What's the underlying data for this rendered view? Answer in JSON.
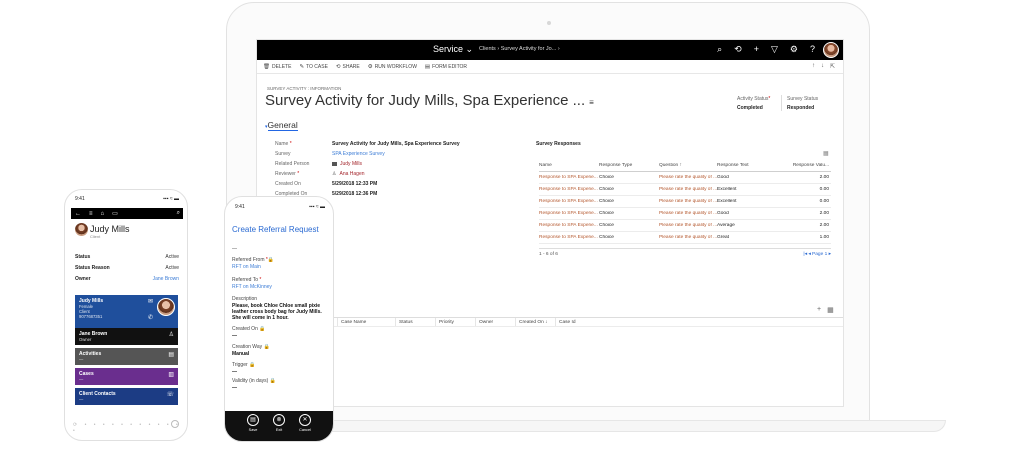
{
  "laptop": {
    "topbar": {
      "app_name": "Service ⌄",
      "breadcrumb": "Clients  ›  Survey Activity for Jo...  ›",
      "icons": [
        "search-icon",
        "history-icon",
        "plus-icon",
        "filter-icon",
        "gear-icon",
        "help-icon"
      ]
    },
    "commands": [
      {
        "icon": "🗑",
        "label": "DELETE"
      },
      {
        "icon": "✎",
        "label": "TO CASE"
      },
      {
        "icon": "⟲",
        "label": "SHARE"
      },
      {
        "icon": "⚙",
        "label": "RUN WORKFLOW"
      },
      {
        "icon": "▤",
        "label": "FORM EDITOR"
      }
    ],
    "record": {
      "overline": "SURVEY ACTIVITY : INFORMATION",
      "title": "Survey Activity for Judy Mills, Spa Experience ...",
      "activity_status_label": "Activity Status",
      "activity_status_value": "Completed",
      "survey_status_label": "Survey Status",
      "survey_status_value": "Responded"
    },
    "tab": "General",
    "fields": [
      {
        "label": "Name",
        "required": true,
        "value": "Survey Activity for Judy Mills, Spa Experience Survey",
        "style": "b"
      },
      {
        "label": "Survey",
        "required": false,
        "value": "SPA Experience Survey",
        "style": "lnk"
      },
      {
        "label": "Related Person",
        "required": false,
        "value": "Judy Mills",
        "style": "red"
      },
      {
        "label": "Reviewer",
        "required": true,
        "value": "Ana Hagen",
        "style": "red"
      },
      {
        "label": "Created On",
        "required": false,
        "value": "5/29/2018   12:33 PM",
        "style": "b"
      },
      {
        "label": "Completed On",
        "required": false,
        "value": "5/29/2018   12:36 PM",
        "style": "b"
      }
    ],
    "survey_responses": {
      "title": "Survey Responses",
      "headers": [
        "Name",
        "Response Type",
        "Question ↑",
        "Response Text",
        "Response Valu..."
      ],
      "rows": [
        [
          "Response to SPA Experie...",
          "Choice",
          "Please rate the quality of ...",
          "Good",
          "2.00"
        ],
        [
          "Response to SPA Experie...",
          "Choice",
          "Please rate the quality of ...",
          "Excellent",
          "0.00"
        ],
        [
          "Response to SPA Experie...",
          "Choice",
          "Please rate the quality of ...",
          "Excellent",
          "0.00"
        ],
        [
          "Response to SPA Experie...",
          "Choice",
          "Please rate the quality of ...",
          "Good",
          "2.00"
        ],
        [
          "Response to SPA Experie...",
          "Choice",
          "Please rate the quality of ...",
          "Average",
          "2.00"
        ],
        [
          "Response to SPA Experie...",
          "Choice",
          "Please rate the quality of ...",
          "Great",
          "1.00"
        ]
      ],
      "count": "1 - 6 of 6",
      "pager": "|◂ ◂ Page 1 ▸"
    },
    "cases_headers": [
      "Case Name",
      "Status",
      "Priority",
      "Owner",
      "Created On ↓",
      "Case Id"
    ]
  },
  "phone1": {
    "time": "9:41",
    "signal": "▪▪▪ ≈ ▬",
    "name": "Judy Mills",
    "subtitle": "Client",
    "status_label": "Status",
    "status_value": "Active",
    "status_reason_label": "Status Reason",
    "status_reason_value": "Active",
    "owner_label": "Owner",
    "owner_value": "Jane Brown",
    "contact_card": {
      "name": "Judy Mills",
      "line1": "Female",
      "line2": "Client",
      "line3": "9077687351"
    },
    "owner_card": {
      "name": "Jane Brown",
      "role": "Owner"
    },
    "activities_label": "Activities",
    "activities_sub": "—",
    "cases_label": "Cases",
    "cases_sub": "—",
    "client_contacts_label": "Client Contacts",
    "client_contacts_sub": "—"
  },
  "phone2": {
    "time": "9:41",
    "signal": "▪▪▪ ≈ ▬",
    "title": "Create Referral Request",
    "top_dash": "—",
    "referred_from_label": "Referred From",
    "referred_from_value": "RFT on Main",
    "referred_to_label": "Referred To",
    "referred_to_value": "RFT on McKinney",
    "description_label": "Description",
    "description_value": "Please, book Chloe Chloe small pixie leather cross body bag for Judy Mills. She will come in 1 hour.",
    "created_on_label": "Created On",
    "created_on_value": "—",
    "creation_way_label": "Creation Way",
    "creation_way_value": "Manual",
    "trigger_label": "Trigger",
    "trigger_value": "—",
    "validity_label": "Validity (in days)",
    "validity_value": "—",
    "actions": [
      {
        "icon": "▤",
        "label": "Save"
      },
      {
        "icon": "⊗",
        "label": "Exit"
      },
      {
        "icon": "✕",
        "label": "Cancel"
      }
    ]
  }
}
